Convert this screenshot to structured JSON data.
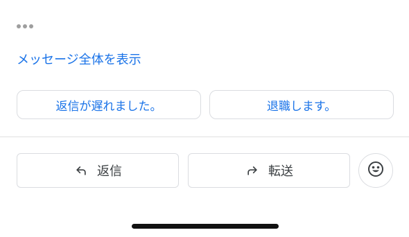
{
  "header": {
    "more_icon": "ellipsis-icon"
  },
  "message": {
    "show_full_message": "メッセージ全体を表示"
  },
  "smart_replies": [
    {
      "label": "返信が遅れました。"
    },
    {
      "label": "退職します。"
    }
  ],
  "actions": {
    "reply": {
      "label": "返信",
      "icon": "reply-icon"
    },
    "forward": {
      "label": "転送",
      "icon": "forward-icon"
    },
    "emoji": {
      "icon": "emoji-reaction-icon"
    }
  },
  "colors": {
    "accent": "#1a73e8",
    "border": "#dadce0",
    "text": "#3c4043"
  }
}
